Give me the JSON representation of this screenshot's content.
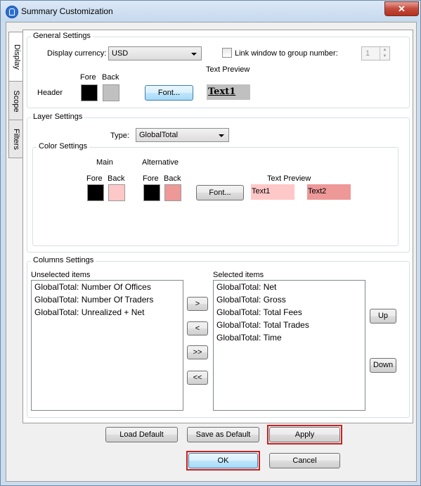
{
  "window": {
    "title": "Summary Customization",
    "close_label": "✕"
  },
  "tabs": [
    {
      "label": "Display"
    },
    {
      "label": "Scope"
    },
    {
      "label": "Filters"
    }
  ],
  "general": {
    "title": "General Settings",
    "currency_label": "Display currency:",
    "currency_value": "USD",
    "link_label": "Link window to group number:",
    "link_checked": false,
    "link_value": "1",
    "fore_label": "Fore",
    "back_label": "Back",
    "header_label": "Header",
    "font_button": "Font...",
    "text_preview_label": "Text Preview",
    "preview_text": "Text1",
    "colors": {
      "fore": "#000000",
      "back": "#c0c0c0",
      "preview_bg": "#c0c0c0"
    }
  },
  "layer": {
    "title": "Layer Settings",
    "type_label": "Type:",
    "type_value": "GlobalTotal",
    "color_settings_title": "Color Settings",
    "main_label": "Main",
    "alternative_label": "Alternative",
    "fore_label": "Fore",
    "back_label": "Back",
    "font_button": "Font...",
    "text_preview_label": "Text Preview",
    "preview1": "Text1",
    "preview2": "Text2",
    "colors": {
      "main_fore": "#000000",
      "main_back": "#ffc8c8",
      "alt_fore": "#000000",
      "alt_back": "#ee9898"
    }
  },
  "columns": {
    "title": "Columns Settings",
    "unselected_label": "Unselected items",
    "unselected": [
      "GlobalTotal: Number Of Offices",
      "GlobalTotal: Number Of Traders",
      "GlobalTotal: Unrealized + Net"
    ],
    "selected_label": "Selected items",
    "selected": [
      "GlobalTotal: Net",
      "GlobalTotal: Gross",
      "GlobalTotal: Total Fees",
      "GlobalTotal: Total Trades",
      "GlobalTotal: Time"
    ],
    "move_right": ">",
    "move_left": "<",
    "move_all_right": ">>",
    "move_all_left": "<<",
    "up": "Up",
    "down": "Down"
  },
  "footer": {
    "load_default": "Load Default",
    "save_default": "Save as Default",
    "apply": "Apply",
    "ok": "OK",
    "cancel": "Cancel"
  },
  "highlight_color": "#cc2020"
}
